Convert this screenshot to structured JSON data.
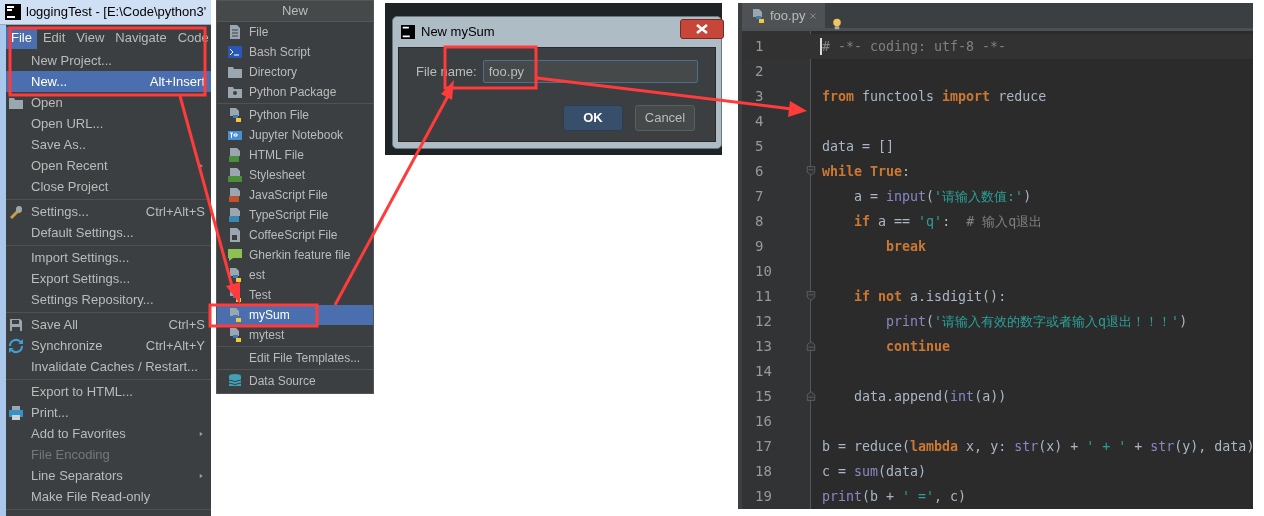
{
  "ide_window": {
    "title": "loggingTest - [E:\\Code\\python3'",
    "menubar": [
      {
        "label": "File",
        "selected": true
      },
      {
        "label": "Edit",
        "selected": false
      },
      {
        "label": "View",
        "selected": false
      },
      {
        "label": "Navigate",
        "selected": false
      },
      {
        "label": "Code",
        "selected": false
      }
    ],
    "file_menu": [
      [
        {
          "label": "New Project...",
          "kind": "plain",
          "selected": false,
          "disabled": false,
          "submenu": false
        },
        {
          "label": "New...",
          "shortcut": "Alt+Insert",
          "kind": "plain",
          "selected": true,
          "disabled": false,
          "submenu": false
        },
        {
          "label": "Open",
          "kind": "folder",
          "selected": false,
          "disabled": false,
          "submenu": false
        },
        {
          "label": "Open URL...",
          "kind": "plain",
          "selected": false,
          "disabled": false,
          "submenu": false
        },
        {
          "label": "Save As..",
          "kind": "plain",
          "selected": false,
          "disabled": false,
          "submenu": false
        },
        {
          "label": "Open Recent",
          "kind": "plain",
          "selected": false,
          "disabled": false,
          "submenu": true
        },
        {
          "label": "Close Project",
          "kind": "plain",
          "selected": false,
          "disabled": false,
          "submenu": false
        }
      ],
      [
        {
          "label": "Settings...",
          "shortcut": "Ctrl+Alt+S",
          "kind": "wrench",
          "selected": false,
          "disabled": false,
          "submenu": false
        },
        {
          "label": "Default Settings...",
          "kind": "plain",
          "selected": false,
          "disabled": false,
          "submenu": false
        }
      ],
      [
        {
          "label": "Import Settings...",
          "kind": "plain",
          "selected": false,
          "disabled": false,
          "submenu": false
        },
        {
          "label": "Export Settings...",
          "kind": "plain",
          "selected": false,
          "disabled": false,
          "submenu": false
        },
        {
          "label": "Settings Repository...",
          "kind": "plain",
          "selected": false,
          "disabled": false,
          "submenu": false
        }
      ],
      [
        {
          "label": "Save All",
          "shortcut": "Ctrl+S",
          "kind": "floppy",
          "selected": false,
          "disabled": false,
          "submenu": false
        },
        {
          "label": "Synchronize",
          "shortcut": "Ctrl+Alt+Y",
          "kind": "sync",
          "selected": false,
          "disabled": false,
          "submenu": false
        },
        {
          "label": "Invalidate Caches / Restart...",
          "kind": "plain",
          "selected": false,
          "disabled": false,
          "submenu": false
        }
      ],
      [
        {
          "label": "Export to HTML...",
          "kind": "plain",
          "selected": false,
          "disabled": false,
          "submenu": false
        },
        {
          "label": "Print...",
          "kind": "printer",
          "selected": false,
          "disabled": false,
          "submenu": false
        },
        {
          "label": "Add to Favorites",
          "kind": "plain",
          "selected": false,
          "disabled": false,
          "submenu": true
        },
        {
          "label": "File Encoding",
          "kind": "plain",
          "selected": false,
          "disabled": true,
          "submenu": false
        },
        {
          "label": "Line Separators",
          "kind": "plain",
          "selected": false,
          "disabled": false,
          "submenu": true
        },
        {
          "label": "Make File Read-only",
          "kind": "plain",
          "selected": false,
          "disabled": false,
          "submenu": false
        }
      ]
    ]
  },
  "new_menu": {
    "title": "New",
    "groups": [
      [
        {
          "label": "File",
          "kind": "file",
          "selected": false
        },
        {
          "label": "Bash Script",
          "kind": "terminal",
          "selected": false
        },
        {
          "label": "Directory",
          "kind": "folder",
          "selected": false
        },
        {
          "label": "Python Package",
          "kind": "package",
          "selected": false
        }
      ],
      [
        {
          "label": "Python File",
          "kind": "python",
          "selected": false
        },
        {
          "label": "Jupyter Notebook",
          "kind": "jupyter",
          "selected": false
        },
        {
          "label": "HTML File",
          "kind": "html",
          "selected": false
        },
        {
          "label": "Stylesheet",
          "kind": "css",
          "selected": false
        },
        {
          "label": "JavaScript File",
          "kind": "js",
          "selected": false
        },
        {
          "label": "TypeScript File",
          "kind": "ts",
          "selected": false
        },
        {
          "label": "CoffeeScript File",
          "kind": "coffee",
          "selected": false
        },
        {
          "label": "Gherkin feature file",
          "kind": "gherkin",
          "selected": false
        },
        {
          "label": "est",
          "kind": "python",
          "selected": false
        },
        {
          "label": "Test",
          "kind": "python",
          "selected": false
        },
        {
          "label": "mySum",
          "kind": "python",
          "selected": true
        },
        {
          "label": "mytest",
          "kind": "python",
          "selected": false
        }
      ],
      [
        {
          "label": "Edit File Templates...",
          "kind": "plain",
          "selected": false
        }
      ],
      [
        {
          "label": "Data Source",
          "kind": "database",
          "selected": false
        }
      ]
    ]
  },
  "dialog": {
    "title": "New mySum",
    "field_label": "File name:",
    "value": "foo.py",
    "buttons": [
      {
        "label": "OK",
        "default": true
      },
      {
        "label": "Cancel",
        "default": false
      }
    ]
  },
  "editor": {
    "tab": "foo.py",
    "lines": [
      {
        "number": "1",
        "kind": "plain",
        "current": true,
        "tokens": [
          {
            "kind": "comment",
            "text": "# -*- coding: utf-8 -*-"
          }
        ]
      },
      {
        "number": "2",
        "kind": "plain",
        "current": false
      },
      {
        "number": "3",
        "kind": "plain",
        "current": false,
        "tokens": [
          {
            "kind": "keyword",
            "text": "from"
          },
          {
            "kind": "plain",
            "text": " functools "
          },
          {
            "kind": "keyword",
            "text": "import"
          },
          {
            "kind": "plain",
            "text": " reduce"
          }
        ]
      },
      {
        "number": "4",
        "kind": "plain",
        "current": false
      },
      {
        "number": "5",
        "kind": "plain",
        "current": false,
        "tokens": [
          {
            "kind": "plain",
            "text": "data = []"
          }
        ]
      },
      {
        "number": "6",
        "kind": "fold-start",
        "current": false,
        "tokens": [
          {
            "kind": "keyword",
            "text": "while True"
          },
          {
            "kind": "plain",
            "text": ":"
          }
        ]
      },
      {
        "number": "7",
        "kind": "plain",
        "current": false,
        "tokens": [
          {
            "kind": "plain",
            "text": "    a = "
          },
          {
            "kind": "builtin",
            "text": "input"
          },
          {
            "kind": "plain",
            "text": "("
          },
          {
            "kind": "string",
            "text": "'请输入数值:'"
          },
          {
            "kind": "plain",
            "text": ")"
          }
        ]
      },
      {
        "number": "8",
        "kind": "plain",
        "current": false,
        "tokens": [
          {
            "kind": "keyword",
            "text": "    if"
          },
          {
            "kind": "plain",
            "text": " a == "
          },
          {
            "kind": "string",
            "text": "'q'"
          },
          {
            "kind": "plain",
            "text": ":  "
          },
          {
            "kind": "comment",
            "text": "# 输入q退出"
          }
        ]
      },
      {
        "number": "9",
        "kind": "plain",
        "current": false,
        "tokens": [
          {
            "kind": "keyword",
            "text": "        break"
          }
        ]
      },
      {
        "number": "10",
        "kind": "plain",
        "current": false
      },
      {
        "number": "11",
        "kind": "fold-start",
        "current": false,
        "tokens": [
          {
            "kind": "keyword",
            "text": "    if not"
          },
          {
            "kind": "plain",
            "text": " a.isdigit():"
          }
        ]
      },
      {
        "number": "12",
        "kind": "plain",
        "current": false,
        "tokens": [
          {
            "kind": "builtin",
            "text": "        print"
          },
          {
            "kind": "plain",
            "text": "("
          },
          {
            "kind": "string",
            "text": "'请输入有效的数字或者输入q退出！！！'"
          },
          {
            "kind": "plain",
            "text": ")"
          }
        ]
      },
      {
        "number": "13",
        "kind": "fold-end",
        "current": false,
        "tokens": [
          {
            "kind": "keyword",
            "text": "        continue"
          }
        ]
      },
      {
        "number": "14",
        "kind": "plain",
        "current": false
      },
      {
        "number": "15",
        "kind": "fold-end",
        "current": false,
        "tokens": [
          {
            "kind": "plain",
            "text": "    data.append("
          },
          {
            "kind": "builtin",
            "text": "int"
          },
          {
            "kind": "plain",
            "text": "(a))"
          }
        ]
      },
      {
        "number": "16",
        "kind": "plain",
        "current": false
      },
      {
        "number": "17",
        "kind": "plain",
        "current": false,
        "tokens": [
          {
            "kind": "plain",
            "text": "b = reduce("
          },
          {
            "kind": "keyword",
            "text": "lambda"
          },
          {
            "kind": "plain",
            "text": " x, y: "
          },
          {
            "kind": "builtin",
            "text": "str"
          },
          {
            "kind": "plain",
            "text": "(x) + "
          },
          {
            "kind": "string",
            "text": "' + '"
          },
          {
            "kind": "plain",
            "text": " + "
          },
          {
            "kind": "builtin",
            "text": "str"
          },
          {
            "kind": "plain",
            "text": "(y), data)"
          }
        ]
      },
      {
        "number": "18",
        "kind": "plain",
        "current": false,
        "tokens": [
          {
            "kind": "plain",
            "text": "c = "
          },
          {
            "kind": "builtin",
            "text": "sum"
          },
          {
            "kind": "plain",
            "text": "(data)"
          }
        ]
      },
      {
        "number": "19",
        "kind": "plain",
        "current": false,
        "tokens": [
          {
            "kind": "builtin",
            "text": "print"
          },
          {
            "kind": "plain",
            "text": "(b + "
          },
          {
            "kind": "string",
            "text": "' ='"
          },
          {
            "kind": "plain",
            "text": ", c)"
          }
        ]
      }
    ]
  }
}
